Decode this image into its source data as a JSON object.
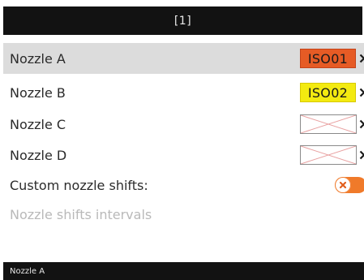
{
  "header": {
    "title": "[1]"
  },
  "rows": [
    {
      "label": "Nozzle A",
      "value": "ISO01",
      "value_color": "#e65b25"
    },
    {
      "label": "Nozzle B",
      "value": "ISO02",
      "value_color": "#f3ea10"
    },
    {
      "label": "Nozzle C",
      "value": ""
    },
    {
      "label": "Nozzle D",
      "value": ""
    }
  ],
  "custom_shifts": {
    "label": "Custom nozzle shifts:",
    "toggle_on": false,
    "toggle_color": "#f07a2a"
  },
  "shift_intervals": {
    "label": "Nozzle shifts intervals"
  },
  "footer": {
    "status": "Nozzle A"
  }
}
